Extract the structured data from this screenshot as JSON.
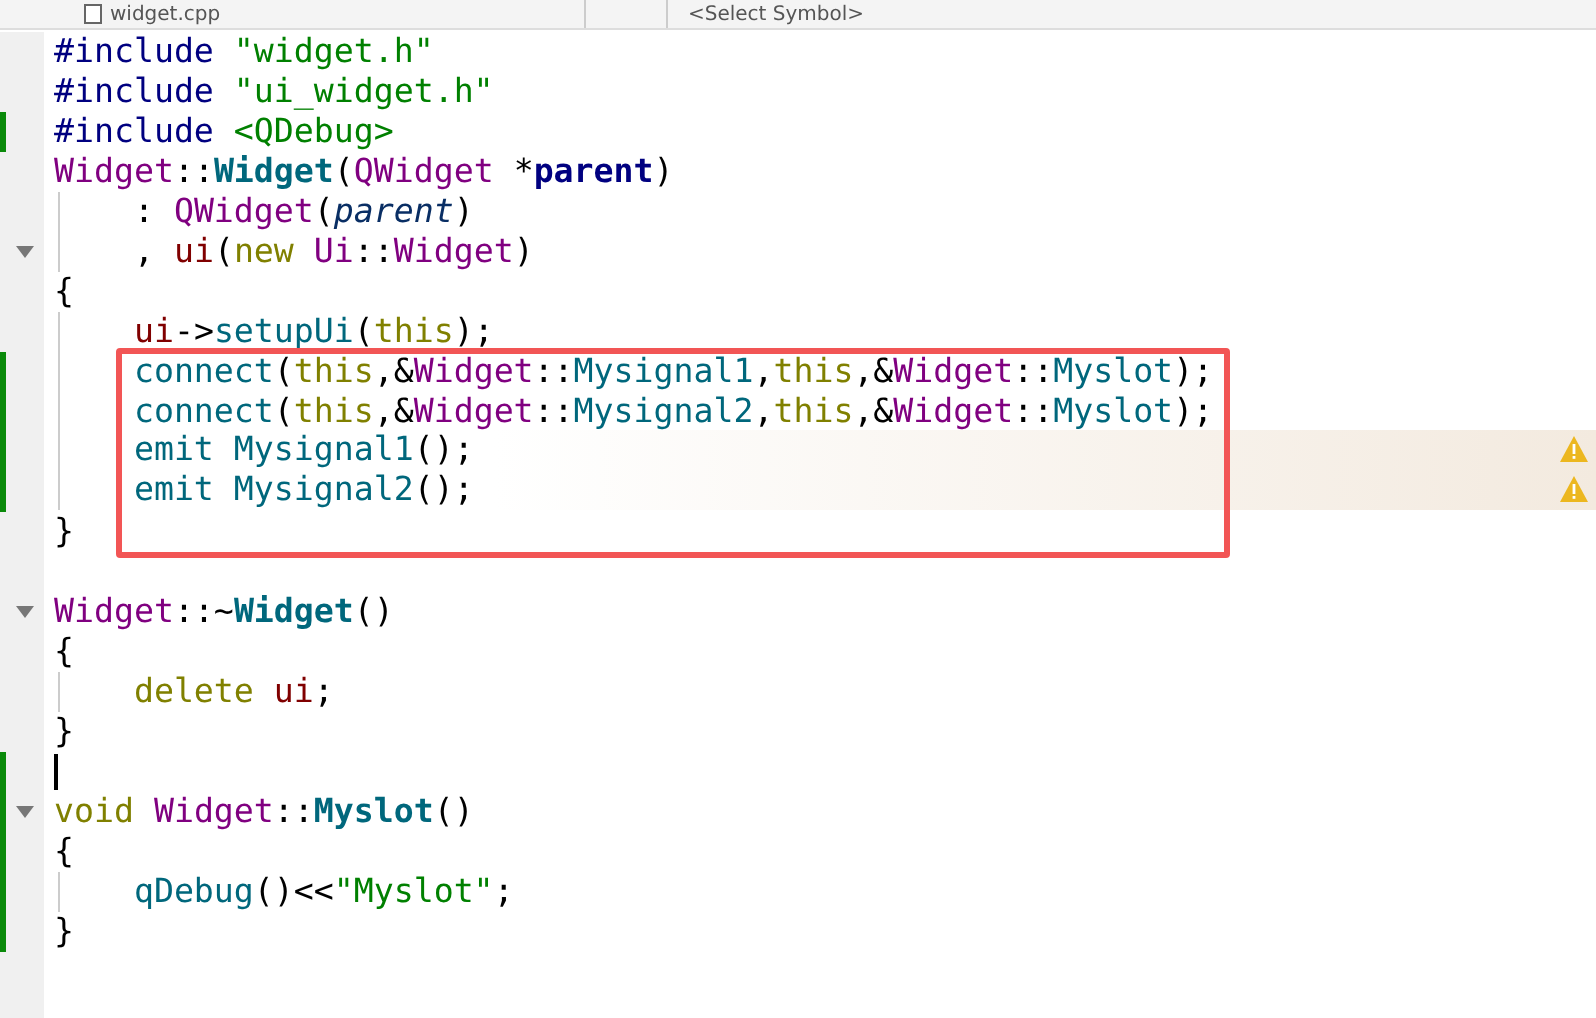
{
  "toolbar": {
    "file_tab": "widget.cpp",
    "symbol_selector": "<Select Symbol>"
  },
  "editor": {
    "lines": [
      {
        "tokens": [
          {
            "text": "#include ",
            "kind": "preproc"
          },
          {
            "text": "\"widget.h\"",
            "kind": "string"
          }
        ]
      },
      {
        "tokens": [
          {
            "text": "#include ",
            "kind": "preproc"
          },
          {
            "text": "\"ui_widget.h\"",
            "kind": "string"
          }
        ]
      },
      {
        "changed": true,
        "tokens": [
          {
            "text": "#include ",
            "kind": "preproc"
          },
          {
            "text": "<QDebug>",
            "kind": "string"
          }
        ]
      },
      {
        "tokens": [
          {
            "text": "Widget",
            "kind": "type"
          },
          {
            "text": "::",
            "kind": "plain"
          },
          {
            "text": "Widget",
            "kind": "decl"
          },
          {
            "text": "(",
            "kind": "plain"
          },
          {
            "text": "QWidget",
            "kind": "type"
          },
          {
            "text": " *",
            "kind": "plain"
          },
          {
            "text": "parent",
            "kind": "param"
          },
          {
            "text": ")",
            "kind": "plain"
          }
        ]
      },
      {
        "guide": true,
        "tokens": [
          {
            "text": "    : ",
            "kind": "plain"
          },
          {
            "text": "QWidget",
            "kind": "type"
          },
          {
            "text": "(",
            "kind": "plain"
          },
          {
            "text": "parent",
            "kind": "param-use"
          },
          {
            "text": ")",
            "kind": "plain"
          }
        ]
      },
      {
        "guide": true,
        "fold": true,
        "tokens": [
          {
            "text": "    , ",
            "kind": "plain"
          },
          {
            "text": "ui",
            "kind": "member"
          },
          {
            "text": "(",
            "kind": "plain"
          },
          {
            "text": "new",
            "kind": "keyword"
          },
          {
            "text": " Ui",
            "kind": "type"
          },
          {
            "text": "::",
            "kind": "plain"
          },
          {
            "text": "Widget",
            "kind": "type"
          },
          {
            "text": ")",
            "kind": "plain"
          }
        ]
      },
      {
        "tokens": [
          {
            "text": "{",
            "kind": "plain"
          }
        ]
      },
      {
        "guide": true,
        "tokens": [
          {
            "text": "    ui",
            "kind": "member"
          },
          {
            "text": "->",
            "kind": "plain"
          },
          {
            "text": "setupUi",
            "kind": "function"
          },
          {
            "text": "(",
            "kind": "plain"
          },
          {
            "text": "this",
            "kind": "keyword"
          },
          {
            "text": ");",
            "kind": "plain"
          }
        ]
      },
      {
        "guide": true,
        "changed": true,
        "boxed": true,
        "tokens": [
          {
            "text": "    connect",
            "kind": "function"
          },
          {
            "text": "(",
            "kind": "plain"
          },
          {
            "text": "this",
            "kind": "keyword"
          },
          {
            "text": ",&",
            "kind": "plain"
          },
          {
            "text": "Widget",
            "kind": "type"
          },
          {
            "text": "::",
            "kind": "plain"
          },
          {
            "text": "Mysignal1",
            "kind": "function"
          },
          {
            "text": ",",
            "kind": "plain"
          },
          {
            "text": "this",
            "kind": "keyword"
          },
          {
            "text": ",&",
            "kind": "plain"
          },
          {
            "text": "Widget",
            "kind": "type"
          },
          {
            "text": "::",
            "kind": "plain"
          },
          {
            "text": "Myslot",
            "kind": "function"
          },
          {
            "text": ");",
            "kind": "plain"
          }
        ]
      },
      {
        "guide": true,
        "changed": true,
        "boxed": true,
        "tokens": [
          {
            "text": "    connect",
            "kind": "function"
          },
          {
            "text": "(",
            "kind": "plain"
          },
          {
            "text": "this",
            "kind": "keyword"
          },
          {
            "text": ",&",
            "kind": "plain"
          },
          {
            "text": "Widget",
            "kind": "type"
          },
          {
            "text": "::",
            "kind": "plain"
          },
          {
            "text": "Mysignal2",
            "kind": "function"
          },
          {
            "text": ",",
            "kind": "plain"
          },
          {
            "text": "this",
            "kind": "keyword"
          },
          {
            "text": ",&",
            "kind": "plain"
          },
          {
            "text": "Widget",
            "kind": "type"
          },
          {
            "text": "::",
            "kind": "plain"
          },
          {
            "text": "Myslot",
            "kind": "function"
          },
          {
            "text": ");",
            "kind": "plain"
          }
        ]
      },
      {
        "guide": true,
        "changed": true,
        "boxed": true,
        "warning": true,
        "tokens": [
          {
            "text": "    emit",
            "kind": "function"
          },
          {
            "text": " Mysignal1",
            "kind": "function"
          },
          {
            "text": "();",
            "kind": "plain"
          }
        ]
      },
      {
        "guide": true,
        "changed": true,
        "boxed": true,
        "warning": true,
        "tokens": [
          {
            "text": "    emit",
            "kind": "function"
          },
          {
            "text": " Mysignal2",
            "kind": "function"
          },
          {
            "text": "();",
            "kind": "plain"
          }
        ]
      },
      {
        "space_after": true,
        "tokens": [
          {
            "text": "}",
            "kind": "plain"
          }
        ]
      },
      {
        "fold": true,
        "tokens": [
          {
            "text": "Widget",
            "kind": "type"
          },
          {
            "text": "::~",
            "kind": "plain"
          },
          {
            "text": "Widget",
            "kind": "decl"
          },
          {
            "text": "()",
            "kind": "plain"
          }
        ]
      },
      {
        "tokens": [
          {
            "text": "{",
            "kind": "plain"
          }
        ]
      },
      {
        "guide": true,
        "tokens": [
          {
            "text": "    delete",
            "kind": "keyword"
          },
          {
            "text": " ui",
            "kind": "member"
          },
          {
            "text": ";",
            "kind": "plain"
          }
        ]
      },
      {
        "tokens": [
          {
            "text": "}",
            "kind": "plain"
          }
        ]
      },
      {
        "changed": true,
        "cursor": true
      },
      {
        "changed": true,
        "fold": true,
        "tokens": [
          {
            "text": "void",
            "kind": "keyword"
          },
          {
            "text": " Widget",
            "kind": "type"
          },
          {
            "text": "::",
            "kind": "plain"
          },
          {
            "text": "Myslot",
            "kind": "decl"
          },
          {
            "text": "()",
            "kind": "plain"
          }
        ]
      },
      {
        "changed": true,
        "tokens": [
          {
            "text": "{",
            "kind": "plain"
          }
        ]
      },
      {
        "changed": true,
        "guide": true,
        "tokens": [
          {
            "text": "    qDebug",
            "kind": "function"
          },
          {
            "text": "()<<",
            "kind": "plain"
          },
          {
            "text": "\"Myslot\"",
            "kind": "string"
          },
          {
            "text": ";",
            "kind": "plain"
          }
        ]
      },
      {
        "changed": true,
        "tokens": [
          {
            "text": "}",
            "kind": "plain"
          }
        ]
      }
    ]
  }
}
